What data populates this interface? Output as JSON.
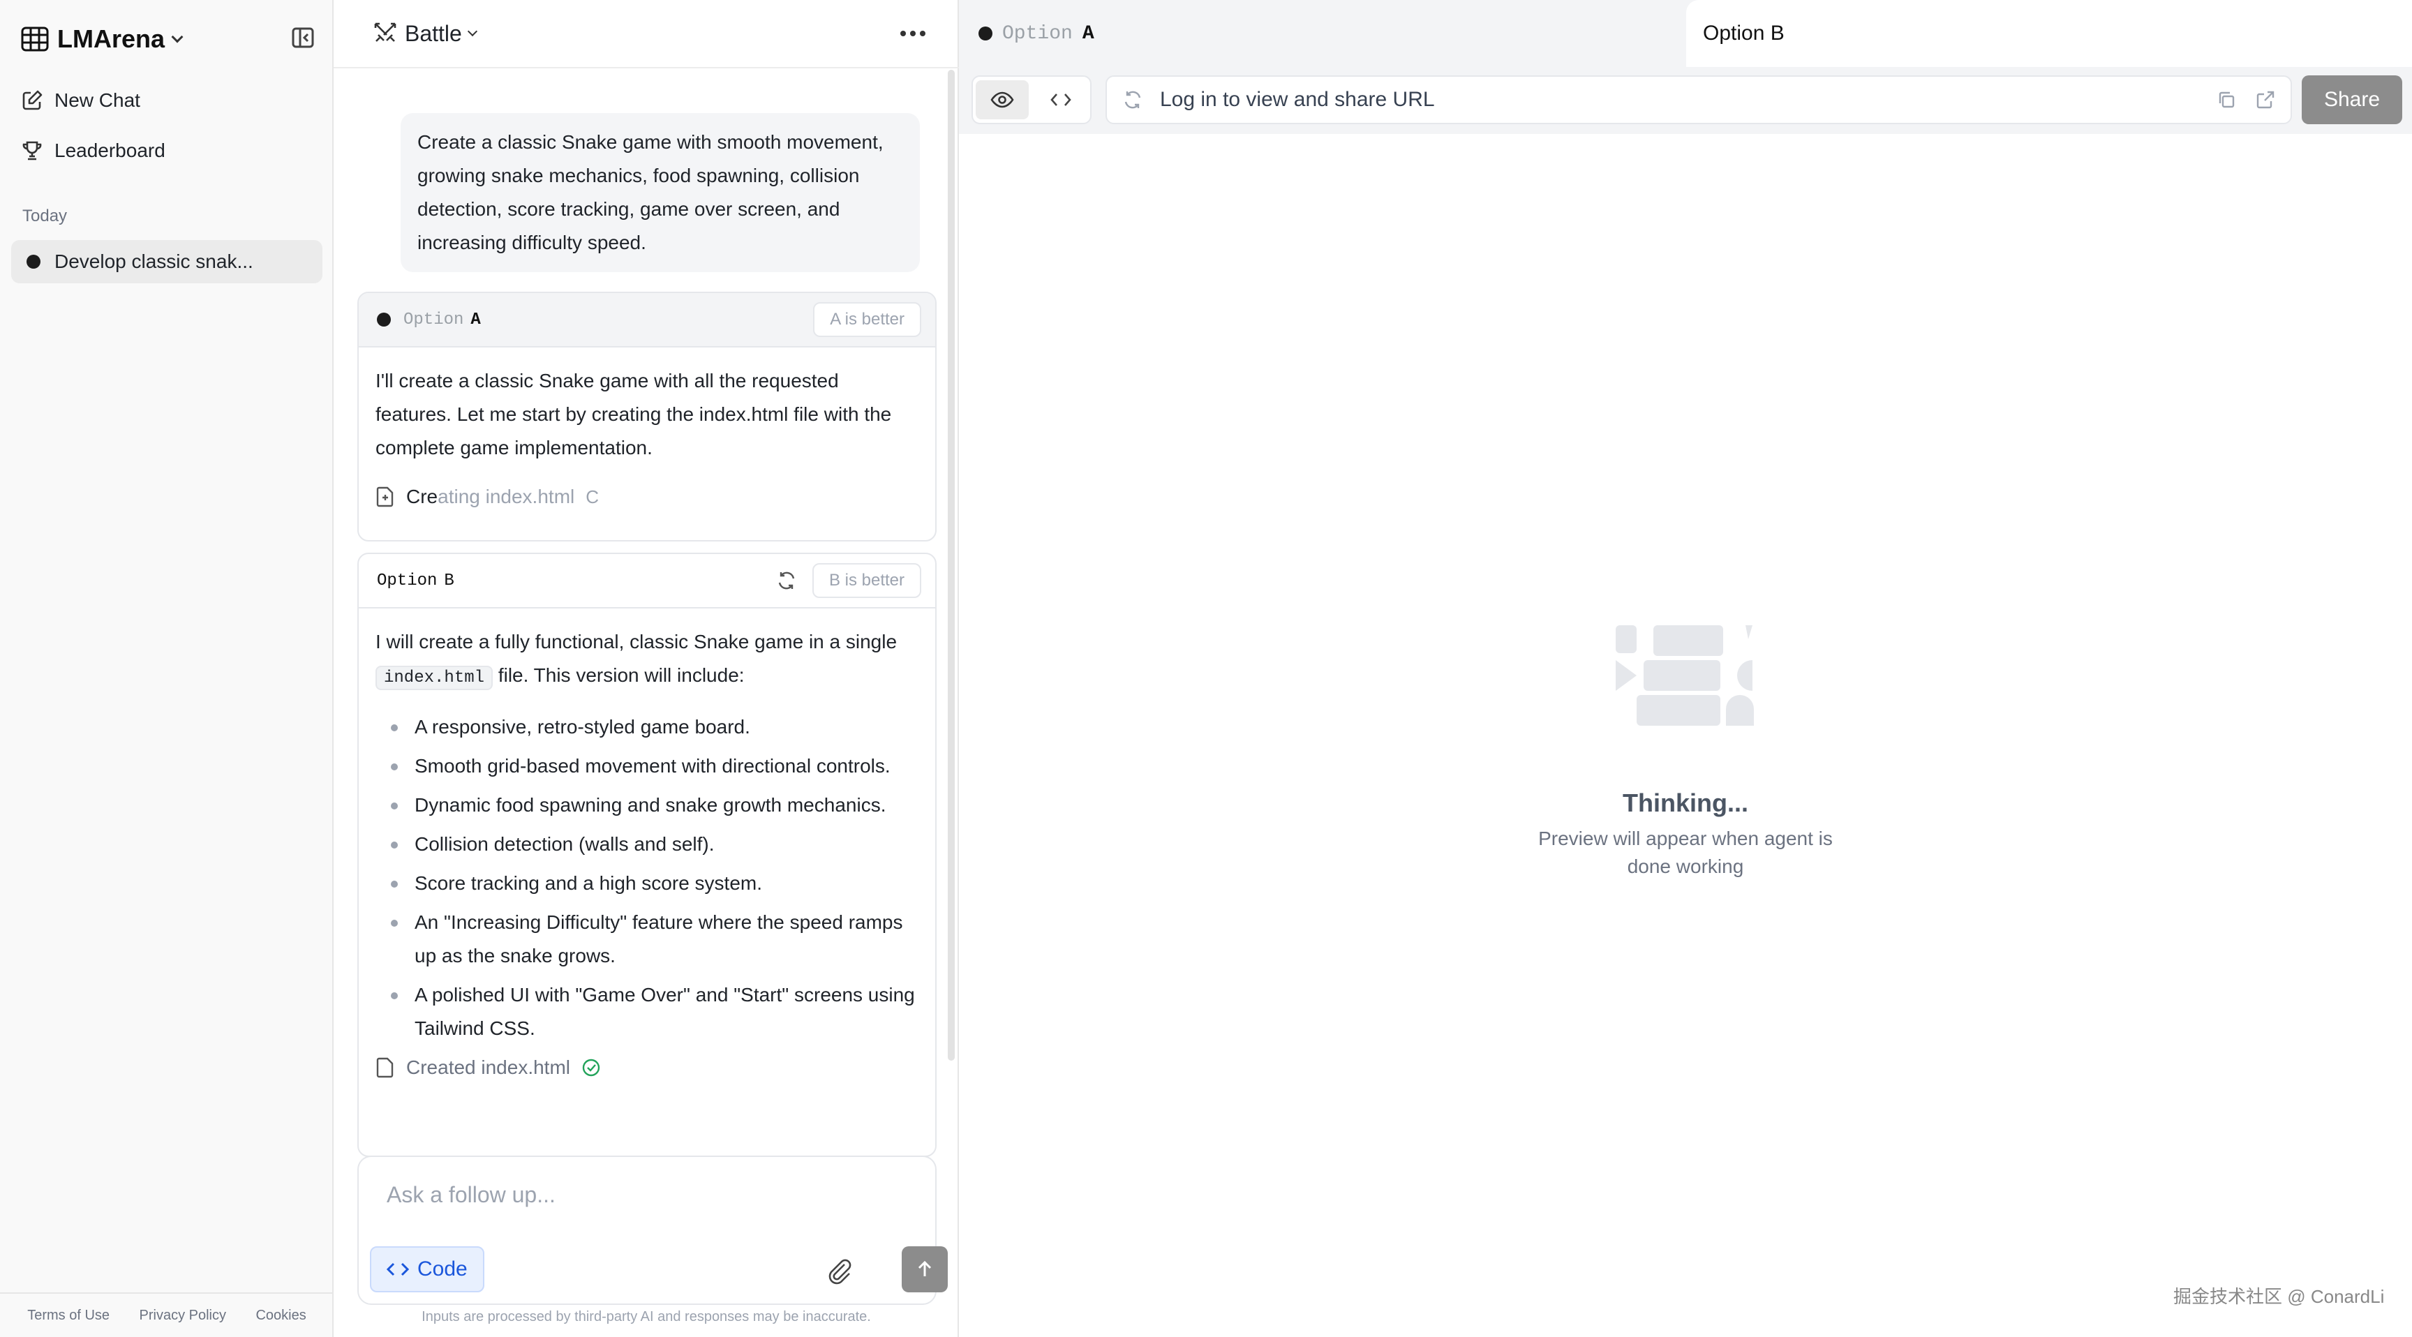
{
  "sidebar": {
    "brand": "LMArena",
    "nav": {
      "new_chat": "New Chat",
      "leaderboard": "Leaderboard"
    },
    "section_today": "Today",
    "chats": [
      {
        "title": "Develop classic snak..."
      }
    ],
    "footer": {
      "terms": "Terms of Use",
      "privacy": "Privacy Policy",
      "cookies": "Cookies"
    }
  },
  "chat": {
    "mode": "Battle",
    "user_prompt": "Create a classic Snake game with smooth movement, growing snake mechanics, food spawning, collision detection, score tracking, game over screen, and increasing difficulty speed.",
    "option_a": {
      "label_word": "Option",
      "label_letter": "A",
      "vote": "A is better",
      "text": "I'll create a classic Snake game with all the requested features. Let me start by creating the index.html file with the complete game implementation.",
      "status_dark": "Cre",
      "status_light": "ating index.html",
      "spinner": "C"
    },
    "option_b": {
      "label_word": "Option",
      "label_letter": "B",
      "vote": "B is better",
      "intro_before": "I will create a fully functional, classic Snake game in a single",
      "intro_code": "index.html",
      "intro_after": "file. This version will include:",
      "features": [
        "A responsive, retro-styled game board.",
        "Smooth grid-based movement with directional controls.",
        "Dynamic food spawning and snake growth mechanics.",
        "Collision detection (walls and self).",
        "Score tracking and a high score system.",
        "An \"Increasing Difficulty\" feature where the speed ramps up as the snake grows.",
        "A polished UI with \"Game Over\" and \"Start\" screens using Tailwind CSS."
      ],
      "status": "Created index.html"
    },
    "composer": {
      "placeholder": "Ask a follow up...",
      "code_label": "Code"
    },
    "disclaimer": "Inputs are processed by third-party AI and responses may be inaccurate."
  },
  "preview": {
    "tab_a": {
      "word": "Option",
      "letter": "A"
    },
    "tab_b": "Option B",
    "url_text": "Log in to view and share URL",
    "share_label": "Share",
    "thinking_title": "Thinking...",
    "thinking_sub": "Preview will appear when agent is done working"
  },
  "watermark": "掘金技术社区 @ ConardLi",
  "colors": {
    "accent_blue": "#1a56db",
    "send_gray": "#8c8c8c",
    "bg_gray": "#f3f4f6"
  }
}
